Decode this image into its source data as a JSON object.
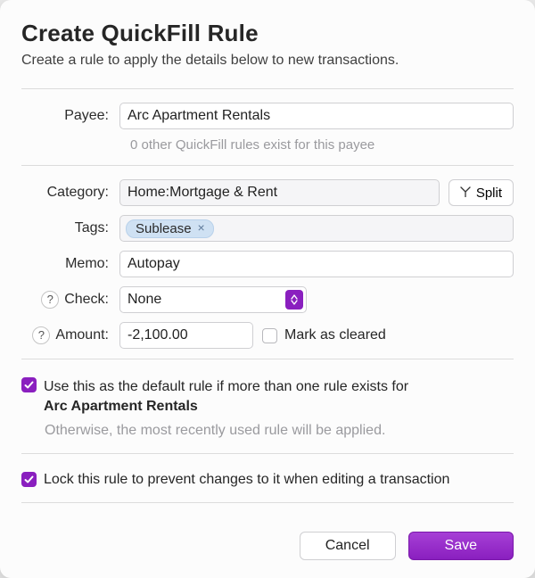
{
  "title": "Create QuickFill Rule",
  "subtitle": "Create a rule to apply the details below to new transactions.",
  "labels": {
    "payee": "Payee:",
    "category": "Category:",
    "tags": "Tags:",
    "memo": "Memo:",
    "check": "Check:",
    "amount": "Amount:"
  },
  "payee": {
    "value": "Arc Apartment Rentals",
    "hint": "0 other QuickFill rules exist for this payee"
  },
  "category": {
    "value": "Home:Mortgage & Rent"
  },
  "split_label": "Split",
  "tags": [
    "Sublease"
  ],
  "memo": {
    "value": "Autopay"
  },
  "check": {
    "value": "None"
  },
  "amount": {
    "value": "-2,100.00"
  },
  "mark_cleared": {
    "label": "Mark as cleared",
    "checked": false
  },
  "default_rule": {
    "checked": true,
    "prefix": "Use this as the default rule if more than one rule exists for",
    "payee": "Arc Apartment Rentals",
    "hint": "Otherwise, the most recently used rule will be applied."
  },
  "lock_rule": {
    "checked": true,
    "label": "Lock this rule to prevent changes to it when editing a transaction"
  },
  "buttons": {
    "cancel": "Cancel",
    "save": "Save"
  }
}
